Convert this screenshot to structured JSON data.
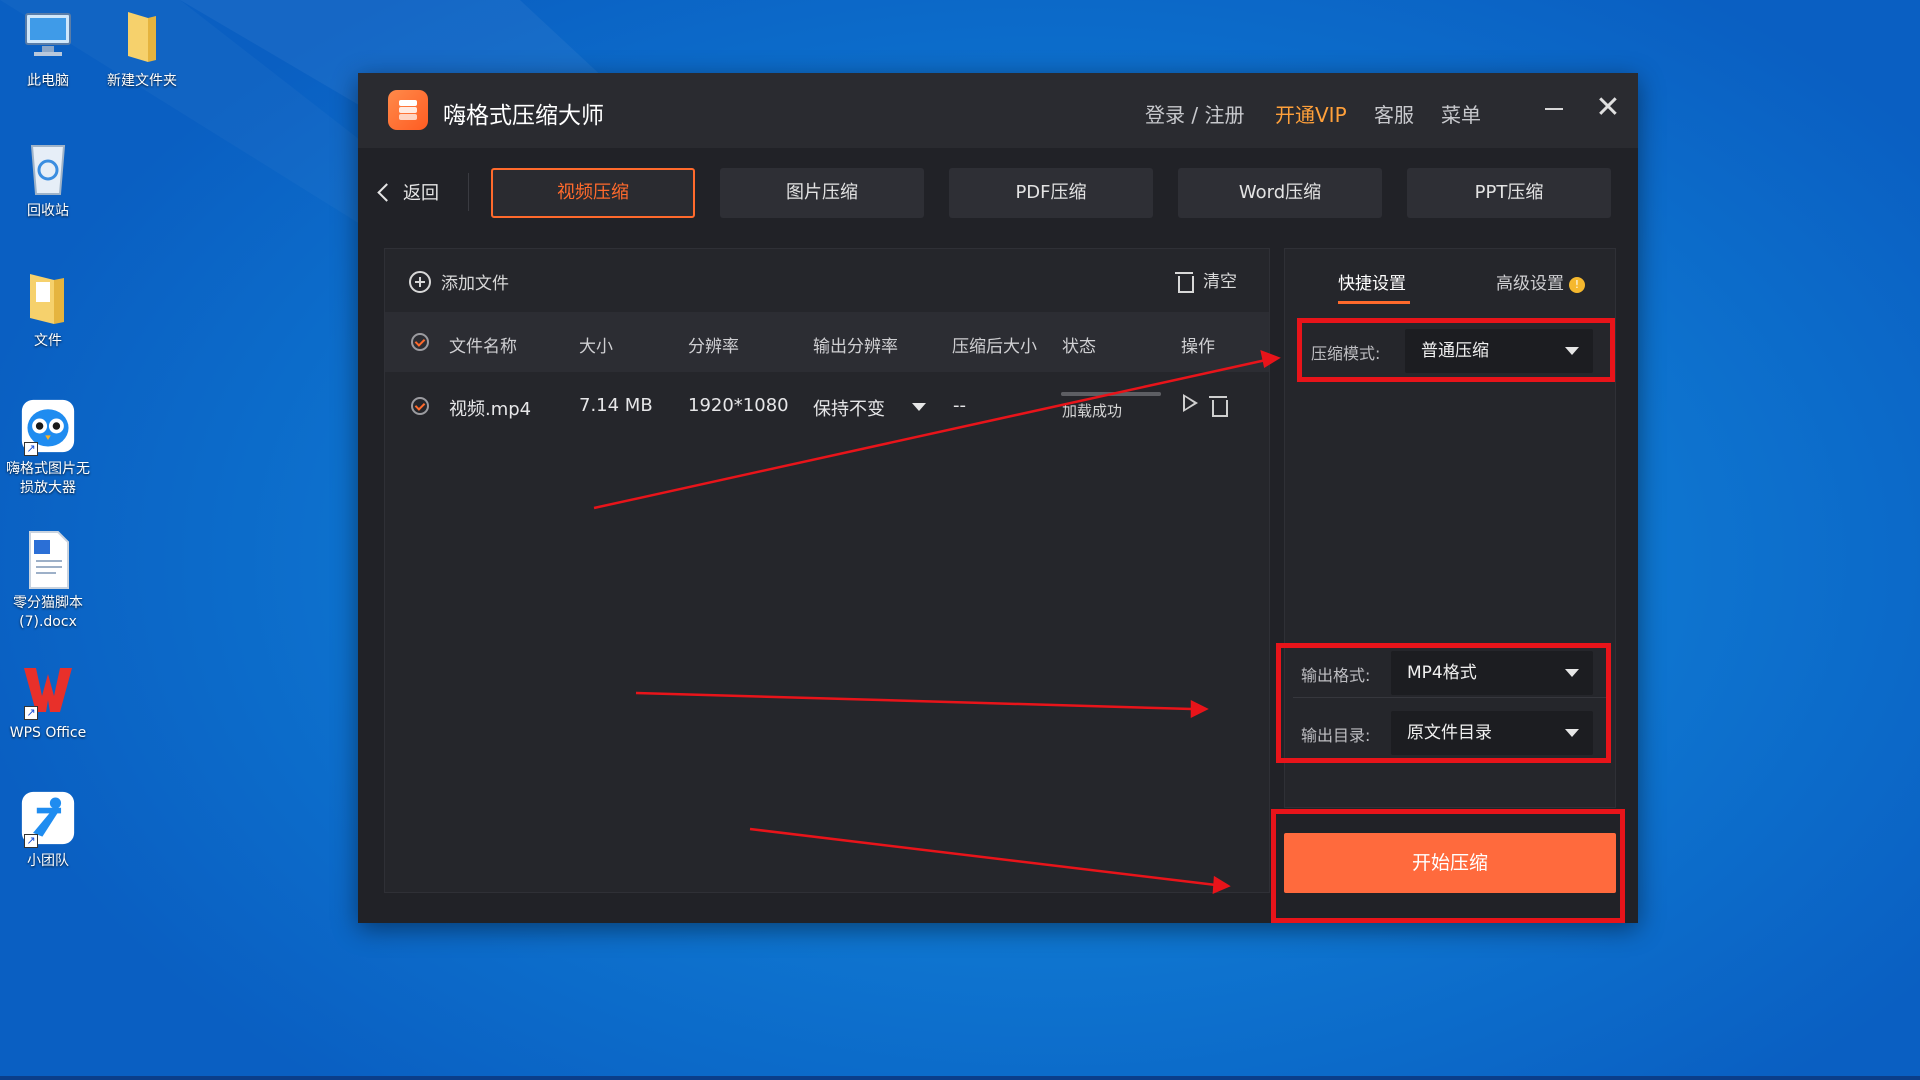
{
  "desktop": {
    "icons": [
      {
        "label": "此电脑",
        "icon": "computer-icon"
      },
      {
        "label": "新建文件夹",
        "icon": "folder-icon"
      },
      {
        "label": "回收站",
        "icon": "recycle-bin-icon"
      },
      {
        "label": "文件",
        "icon": "folder-icon"
      },
      {
        "label": "嗨格式图片无损放大器",
        "icon": "owl-app-icon"
      },
      {
        "label": "零分猫脚本(7).docx",
        "icon": "word-doc-icon"
      },
      {
        "label": "WPS Office",
        "icon": "wps-icon"
      },
      {
        "label": "小团队",
        "icon": "team-app-icon"
      }
    ]
  },
  "window": {
    "title": "嗨格式压缩大师",
    "links": {
      "login": "登录 / 注册",
      "vip": "开通VIP",
      "service": "客服",
      "menu": "菜单"
    },
    "controls": {
      "minimize": "minimize-icon",
      "close": "✕"
    }
  },
  "nav": {
    "back": "返回",
    "tabs": [
      "视频压缩",
      "图片压缩",
      "PDF压缩",
      "Word压缩",
      "PPT压缩"
    ],
    "active_tab": "视频压缩"
  },
  "file_panel": {
    "add_file": "添加文件",
    "clear": "清空",
    "columns": [
      "文件名称",
      "大小",
      "分辨率",
      "输出分辨率",
      "压缩后大小",
      "状态",
      "操作"
    ],
    "rows": [
      {
        "name": "视频.mp4",
        "size": "7.14 MB",
        "resolution": "1920*1080",
        "output_resolution": "保持不变",
        "compressed_size": "--",
        "status": "加载成功",
        "progress": 1.0
      }
    ]
  },
  "settings": {
    "tabs": {
      "quick": "快捷设置",
      "advanced": "高级设置"
    },
    "info_badge": "!",
    "mode_label": "压缩模式:",
    "mode_value": "普通压缩",
    "format_label": "输出格式:",
    "format_value": "MP4格式",
    "dir_label": "输出目录:",
    "dir_value": "原文件目录"
  },
  "start_button": "开始压缩",
  "colors": {
    "accent": "#ff6a2c",
    "start_button": "#ff6a3d",
    "vip": "#ffa03a",
    "annotation": "#e8141a",
    "window_bg": "#212227"
  }
}
